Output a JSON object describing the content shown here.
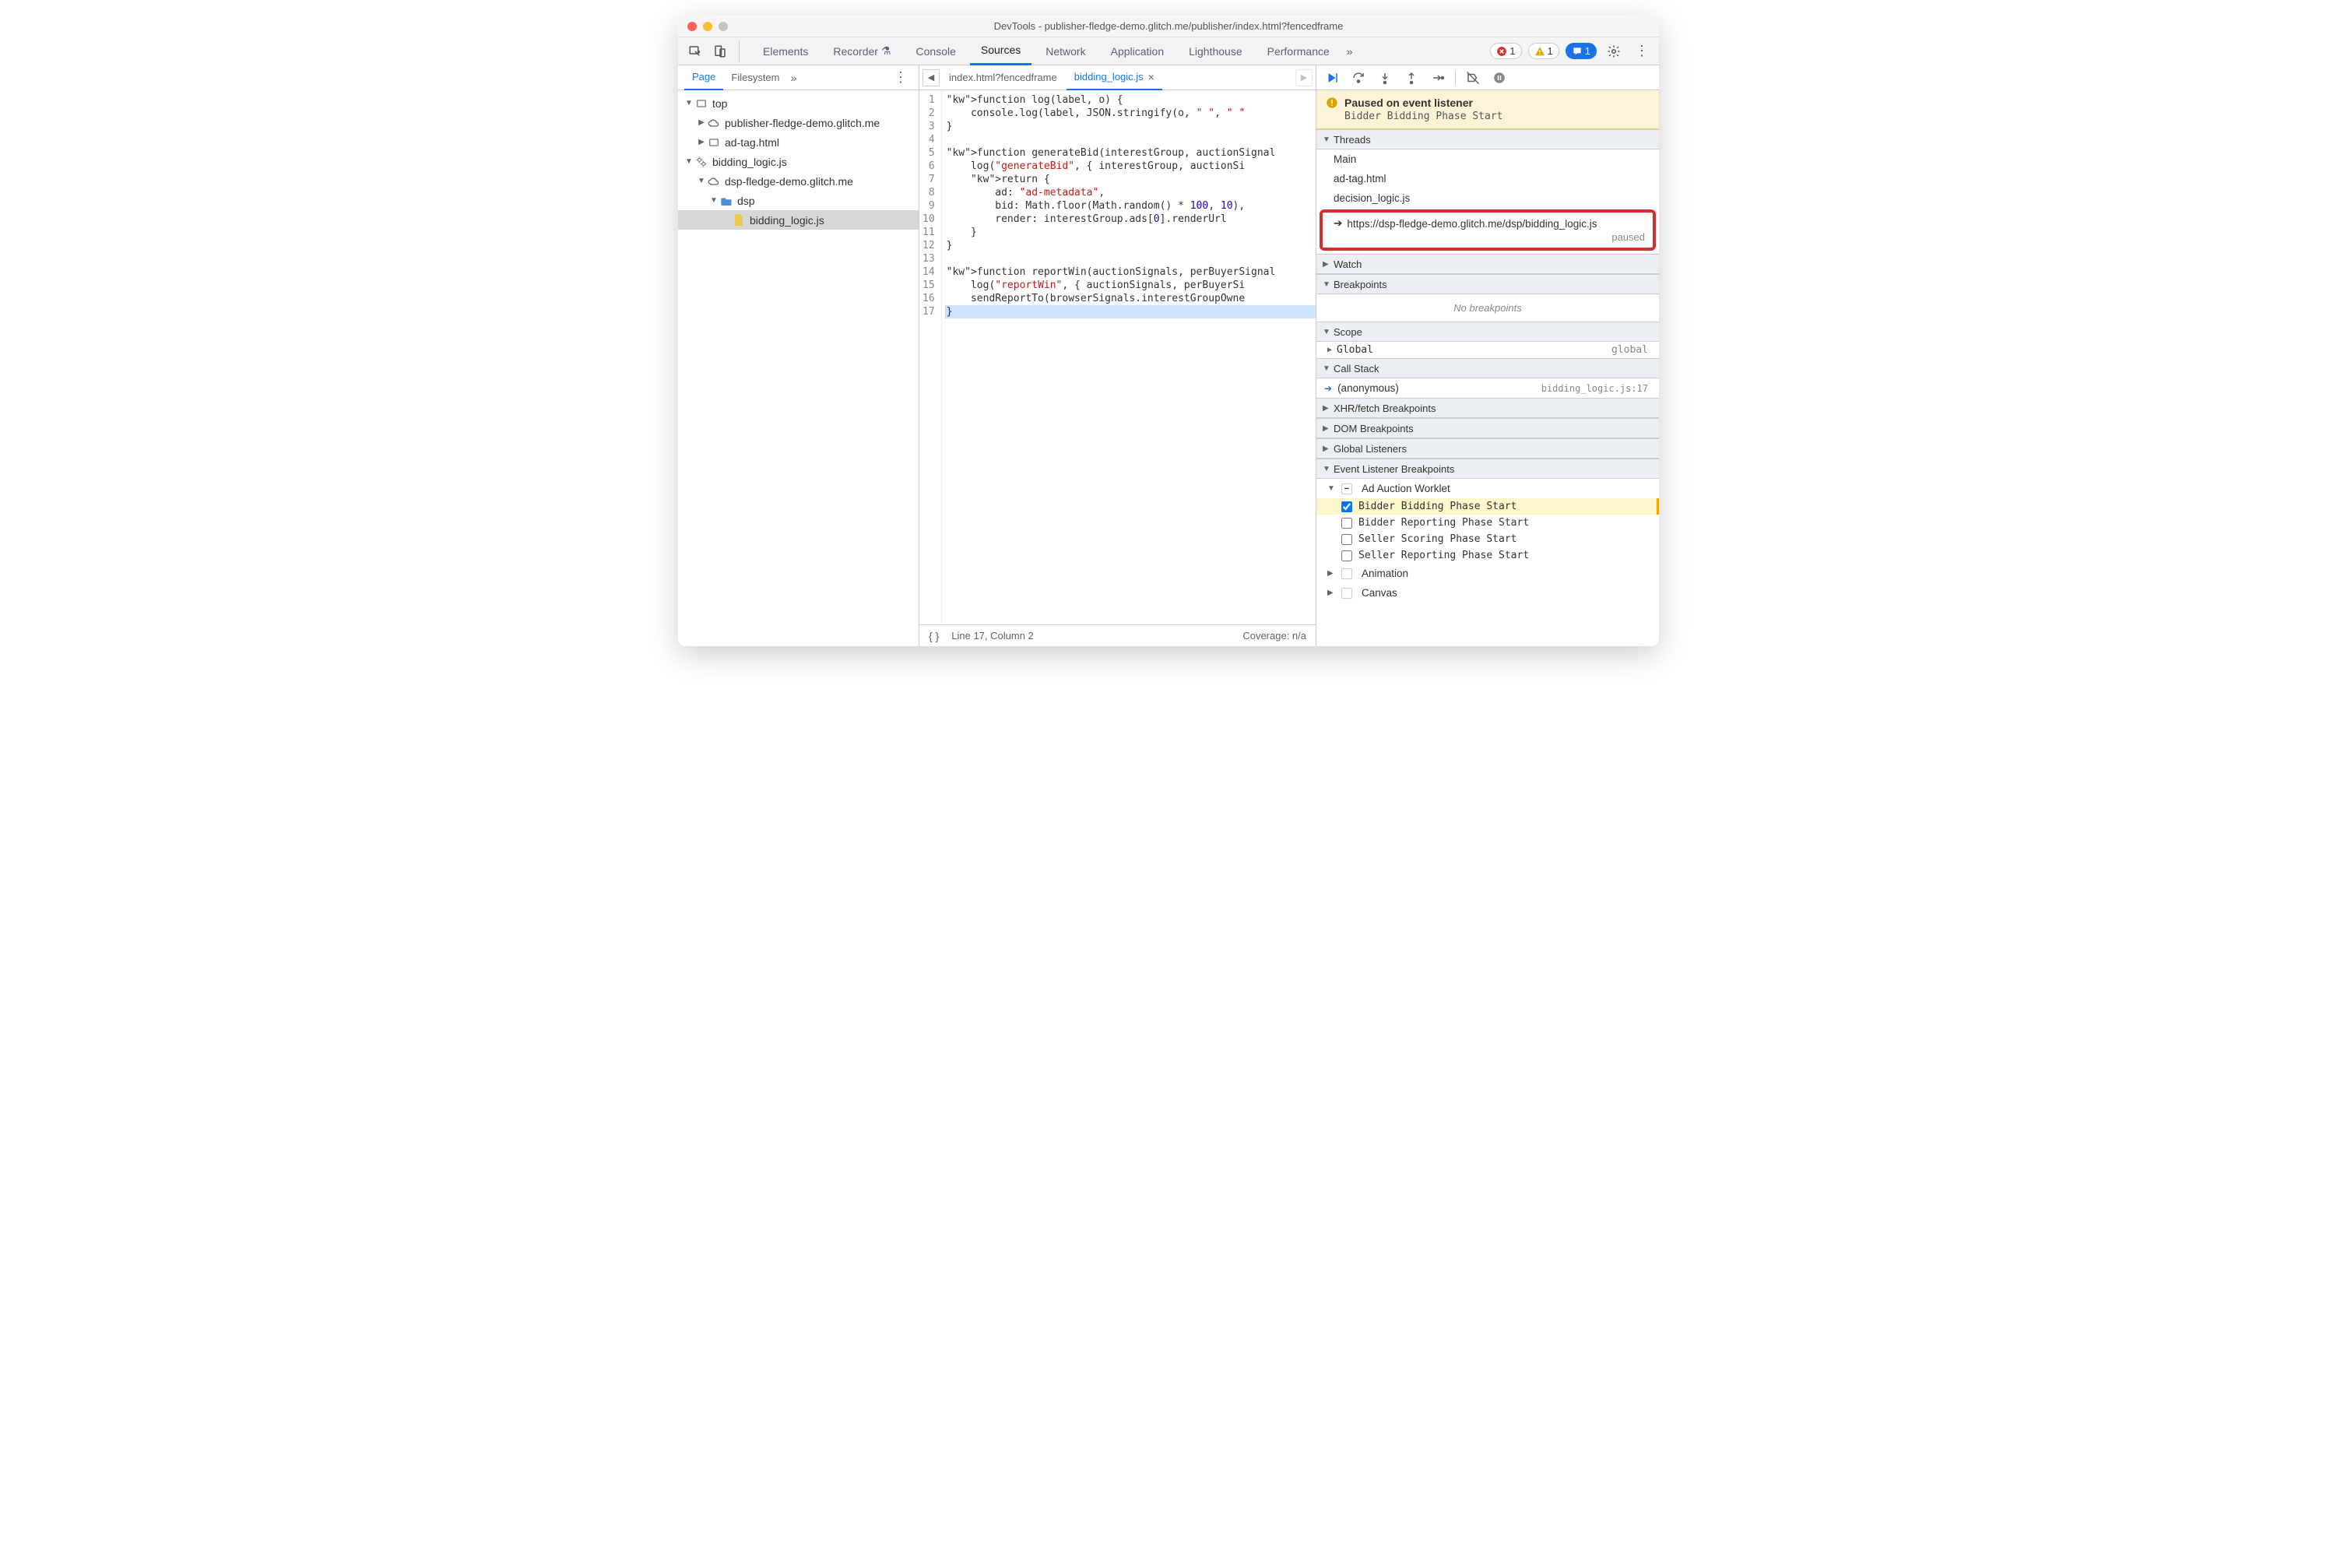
{
  "window_title": "DevTools - publisher-fledge-demo.glitch.me/publisher/index.html?fencedframe",
  "main_tabs": [
    "Elements",
    "Recorder",
    "Console",
    "Sources",
    "Network",
    "Application",
    "Lighthouse",
    "Performance"
  ],
  "active_main_tab": "Sources",
  "badges": {
    "errors": "1",
    "warnings": "1",
    "info": "1"
  },
  "left_tabs": [
    "Page",
    "Filesystem"
  ],
  "active_left_tab": "Page",
  "tree": {
    "top": "top",
    "pub_domain": "publisher-fledge-demo.glitch.me",
    "ad_tag": "ad-tag.html",
    "bidding_worklet": "bidding_logic.js",
    "dsp_domain": "dsp-fledge-demo.glitch.me",
    "dsp_folder": "dsp",
    "bidding_file": "bidding_logic.js"
  },
  "editor_tabs": [
    {
      "label": "index.html?fencedframe",
      "active": false
    },
    {
      "label": "bidding_logic.js",
      "active": true
    }
  ],
  "code_lines": [
    "function log(label, o) {",
    "    console.log(label, JSON.stringify(o, \" \", \" \"",
    "}",
    "",
    "function generateBid(interestGroup, auctionSignal",
    "    log(\"generateBid\", { interestGroup, auctionSi",
    "    return {",
    "        ad: \"ad-metadata\",",
    "        bid: Math.floor(Math.random() * 100, 10),",
    "        render: interestGroup.ads[0].renderUrl",
    "    }",
    "}",
    "",
    "function reportWin(auctionSignals, perBuyerSignal",
    "    log(\"reportWin\", { auctionSignals, perBuyerSi",
    "    sendReportTo(browserSignals.interestGroupOwne",
    "}"
  ],
  "status_bar": {
    "pos": "Line 17, Column 2",
    "coverage": "Coverage: n/a"
  },
  "paused": {
    "title": "Paused on event listener",
    "sub": "Bidder Bidding Phase Start"
  },
  "threads": {
    "header": "Threads",
    "items": [
      "Main",
      "ad-tag.html",
      "decision_logic.js"
    ],
    "highlighted": {
      "url": "https://dsp-fledge-demo.glitch.me/dsp/bidding_logic.js",
      "status": "paused"
    }
  },
  "watch_header": "Watch",
  "breakpoints": {
    "header": "Breakpoints",
    "empty": "No breakpoints"
  },
  "scope": {
    "header": "Scope",
    "global_label": "Global",
    "global_value": "global"
  },
  "callstack": {
    "header": "Call Stack",
    "frame": "(anonymous)",
    "loc": "bidding_logic.js:17"
  },
  "xhr_header": "XHR/fetch Breakpoints",
  "dom_header": "DOM Breakpoints",
  "global_listeners_header": "Global Listeners",
  "event_bp": {
    "header": "Event Listener Breakpoints",
    "ad_auction": "Ad Auction Worklet",
    "items": [
      {
        "label": "Bidder Bidding Phase Start",
        "checked": true,
        "hit": true
      },
      {
        "label": "Bidder Reporting Phase Start",
        "checked": false
      },
      {
        "label": "Seller Scoring Phase Start",
        "checked": false
      },
      {
        "label": "Seller Reporting Phase Start",
        "checked": false
      }
    ],
    "animation": "Animation",
    "canvas": "Canvas"
  }
}
